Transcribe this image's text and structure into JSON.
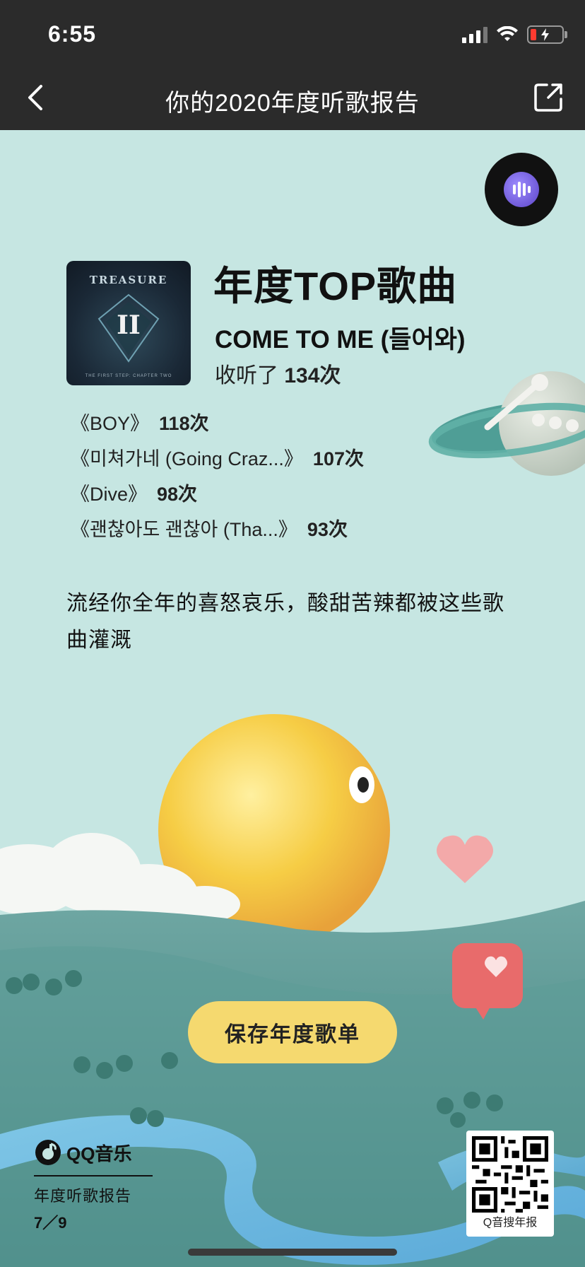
{
  "status_bar": {
    "time": "6:55"
  },
  "nav": {
    "title": "你的2020年度听歌报告",
    "back_icon": "chevron-left-icon",
    "share_icon": "share-icon"
  },
  "album": {
    "brand_text": "TREASURE",
    "roman_text": "II",
    "caption_text": "THE FIRST STEP: CHAPTER TWO"
  },
  "top_song": {
    "heading": "年度TOP歌曲",
    "title": "COME TO ME (들어와)",
    "plays_prefix": "收听了",
    "plays_value": "134次"
  },
  "song_list": [
    {
      "title": "《BOY》",
      "count": "118次"
    },
    {
      "title": "《미쳐가네 (Going Craz...》",
      "count": "107次"
    },
    {
      "title": "《Dive》",
      "count": "98次"
    },
    {
      "title": "《괜찮아도 괜찮아 (Tha...》",
      "count": "93次"
    }
  ],
  "caption": "流经你全年的喜怒哀乐，酸甜苦辣都被这些歌曲灌溉",
  "save_button": "保存年度歌单",
  "brand": {
    "name": "QQ音乐",
    "report_label": "年度听歌报告",
    "page_indicator": "7／9"
  },
  "qr": {
    "label": "Q音搜年报"
  },
  "colors": {
    "background": "#c6e6e2",
    "header": "#2b2b2b",
    "accent_button": "#f5d96f"
  }
}
